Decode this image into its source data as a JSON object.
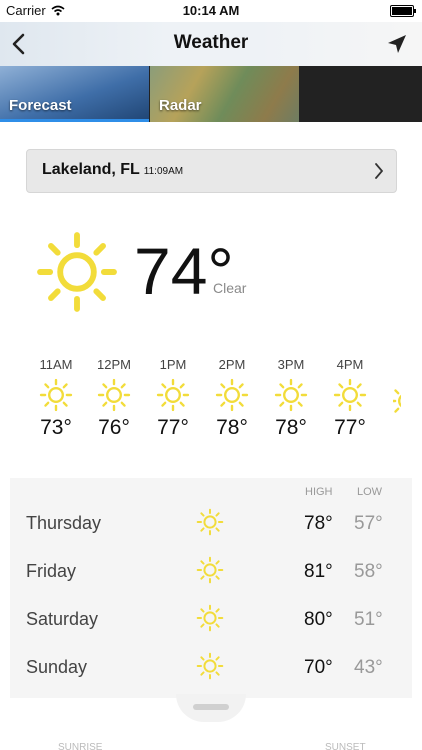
{
  "status_bar": {
    "carrier": "Carrier",
    "time": "10:14 AM"
  },
  "navbar": {
    "title": "Weather"
  },
  "tabs": [
    {
      "label": "Forecast",
      "selected": true
    },
    {
      "label": "Radar",
      "selected": false
    }
  ],
  "location": {
    "city": "Lakeland, FL",
    "time": "11:09AM"
  },
  "current": {
    "temp": "74°",
    "condition": "Clear"
  },
  "hourly": [
    {
      "hour": "11AM",
      "temp": "73°"
    },
    {
      "hour": "12PM",
      "temp": "76°"
    },
    {
      "hour": "1PM",
      "temp": "77°"
    },
    {
      "hour": "2PM",
      "temp": "78°"
    },
    {
      "hour": "3PM",
      "temp": "78°"
    },
    {
      "hour": "4PM",
      "temp": "77°"
    }
  ],
  "daily_header": {
    "high": "HIGH",
    "low": "LOW"
  },
  "daily": [
    {
      "day": "Thursday",
      "high": "78°",
      "low": "57°"
    },
    {
      "day": "Friday",
      "high": "81°",
      "low": "58°"
    },
    {
      "day": "Saturday",
      "high": "80°",
      "low": "51°"
    },
    {
      "day": "Sunday",
      "high": "70°",
      "low": "43°"
    }
  ],
  "footer": {
    "sunrise": "SUNRISE",
    "sunset": "SUNSET"
  },
  "colors": {
    "sun": "#f2dc3a",
    "tab_accent": "#2f8ee8"
  },
  "icons": [
    "wifi-icon",
    "battery-icon",
    "back-chevron-icon",
    "location-arrow-icon",
    "chevron-right-icon",
    "sun-icon"
  ]
}
